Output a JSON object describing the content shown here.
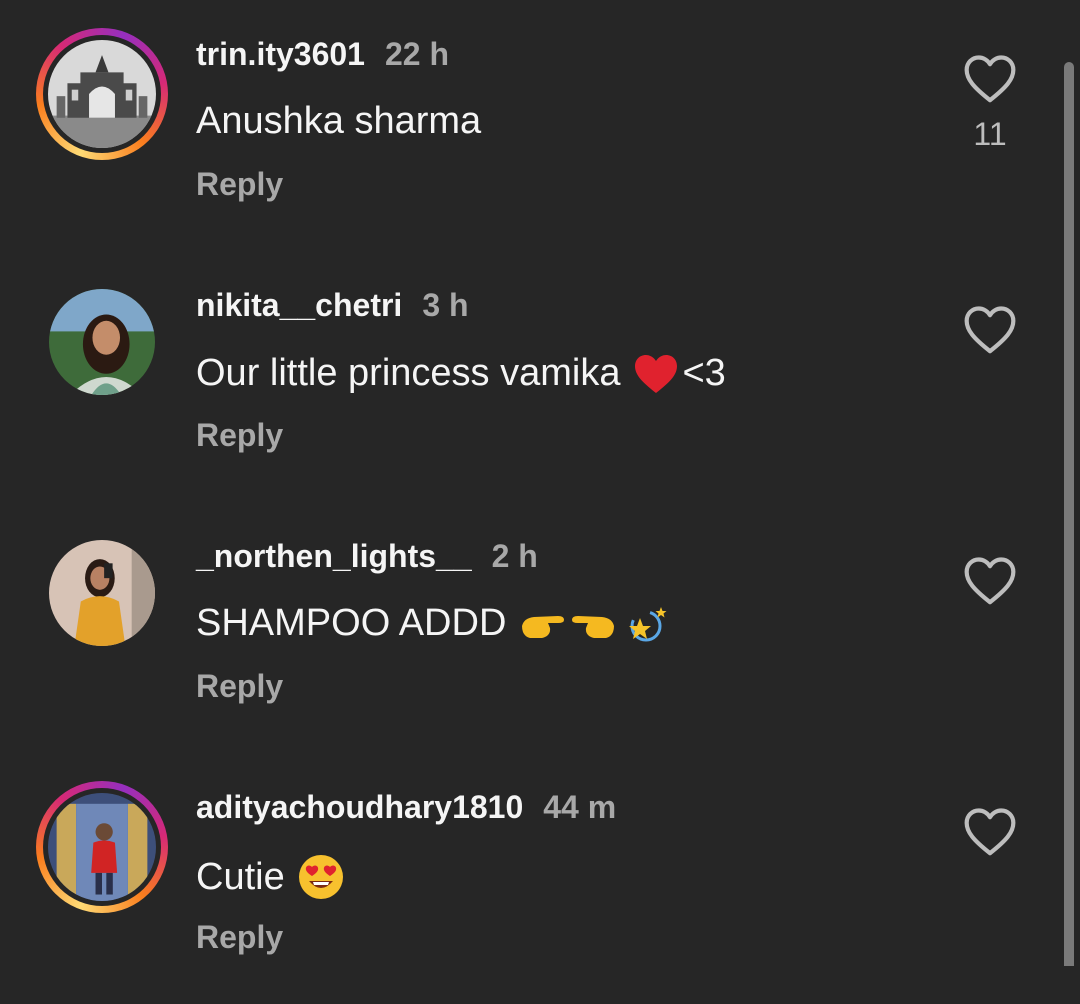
{
  "comments": [
    {
      "username": "trin.ity3601",
      "time": "22 h",
      "text": "Anushka sharma",
      "emoji_after": "",
      "suffix": "",
      "reply_label": "Reply",
      "like_count": "11",
      "story_ring": true,
      "avatar_icon": "building-photo"
    },
    {
      "username": "nikita__chetri",
      "time": "3 h",
      "text": "Our little princess vamika",
      "emoji_after": "red-heart-emoji",
      "suffix": "<3",
      "reply_label": "Reply",
      "like_count": "",
      "story_ring": false,
      "avatar_icon": "woman-photo"
    },
    {
      "username": "_northen_lights__",
      "time": "2 h",
      "text": "SHAMPOO ADDD",
      "emoji_after": "pointing-hands-dizzy-emoji",
      "suffix": "",
      "reply_label": "Reply",
      "like_count": "",
      "story_ring": false,
      "avatar_icon": "woman-selfie-photo"
    },
    {
      "username": "adityachoudhary1810",
      "time": "44 m",
      "text": "Cutie",
      "emoji_after": "heart-eyes-emoji",
      "suffix": "",
      "reply_label": "Reply",
      "like_count": "",
      "story_ring": true,
      "avatar_icon": "man-red-shirt-photo"
    }
  ],
  "colors": {
    "background": "#262626",
    "secondary_text": "#a8a8a8",
    "primary_text": "#f5f5f5"
  }
}
